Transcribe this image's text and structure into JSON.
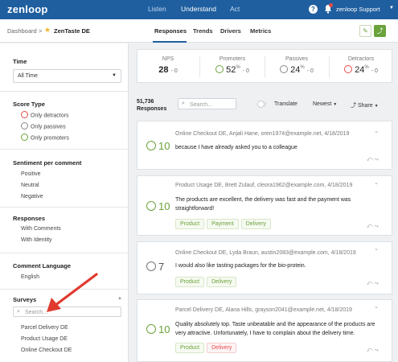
{
  "app": {
    "logo": "zenloop",
    "nav": [
      "Listen",
      "Understand",
      "Act"
    ],
    "user": "zenloop Support"
  },
  "header": {
    "breadcrumb_root": "Dashboard",
    "breadcrumb_sep": ">",
    "survey_name": "ZenTaste DE",
    "tabs": [
      "Responses",
      "Trends",
      "Drivers",
      "Metrics"
    ],
    "active_tab": "Responses"
  },
  "sidebar": {
    "time_title": "Time",
    "time_value": "All Time",
    "score_title": "Score Type",
    "score_items": [
      "Only detractors",
      "Only passives",
      "Only promoters"
    ],
    "sentiment_title": "Sentiment per comment",
    "sentiment_items": [
      "Positive",
      "Neutral",
      "Negative"
    ],
    "responses_title": "Responses",
    "responses_items": [
      "With Comments",
      "With Identity"
    ],
    "language_title": "Comment Language",
    "language_items": [
      "English"
    ],
    "surveys_title": "Surveys",
    "surveys_search_placeholder": "Search...",
    "surveys_items": [
      "Parcel Delivery DE",
      "Product Usage DE",
      "Online Checkout DE"
    ]
  },
  "metrics": {
    "nps_label": "NPS",
    "nps_value": "28",
    "nps_delta": "- 0",
    "promoters_label": "Promoters",
    "promoters_value": "52",
    "promoters_unit": "%",
    "promoters_delta": "- 0",
    "passives_label": "Passives",
    "passives_value": "24",
    "passives_unit": "%",
    "passives_delta": "- 0",
    "detractors_label": "Detractors",
    "detractors_value": "24",
    "detractors_unit": "%",
    "detractors_delta": "- 0"
  },
  "list": {
    "count_value": "51,736",
    "count_label": "Responses",
    "search_placeholder": "Search...",
    "translate_label": "Translate",
    "sort_label": "Newest",
    "share_label": "Share"
  },
  "responses": [
    {
      "score": "10",
      "meta": "Online Checkout DE, Anjali Hane, oren1974@example.net, 4/18/2019",
      "text": "because I have already asked you to a colleague",
      "tags": []
    },
    {
      "score": "10",
      "meta": "Product Usage DE, Brett Zulauf, cleora1962@example.com, 4/18/2019",
      "text": "The products are excellent, the delivery was fast and the payment was straightforward!",
      "tags": [
        {
          "label": "Product",
          "tone": "green"
        },
        {
          "label": "Payment",
          "tone": "green"
        },
        {
          "label": "Delivery",
          "tone": "green"
        }
      ]
    },
    {
      "score": "7",
      "meta": "Online Checkout DE, Lyda Braun, austin2083@example.com, 4/18/2019",
      "text": "I would also like tasting packages for the bio-protein.",
      "tags": [
        {
          "label": "Product",
          "tone": "green"
        },
        {
          "label": "Delivery",
          "tone": "green"
        }
      ]
    },
    {
      "score": "10",
      "meta": "Parcel Delivery DE, Alana Hills, grayson2041@example.net, 4/18/2019",
      "text": "Quality absolutely top. Taste unbeatable and the appearance of the products are very attractive. Unfortunately, I have to complain about the delivery time.",
      "tags": [
        {
          "label": "Product",
          "tone": "green"
        },
        {
          "label": "Delivery",
          "tone": "red"
        }
      ]
    }
  ],
  "colors": {
    "brand": "#1f5fa0",
    "promoter": "#6aa23c",
    "passive": "#888888",
    "detractor": "#e54b4b",
    "annotation_arrow": "#e03a2f"
  }
}
